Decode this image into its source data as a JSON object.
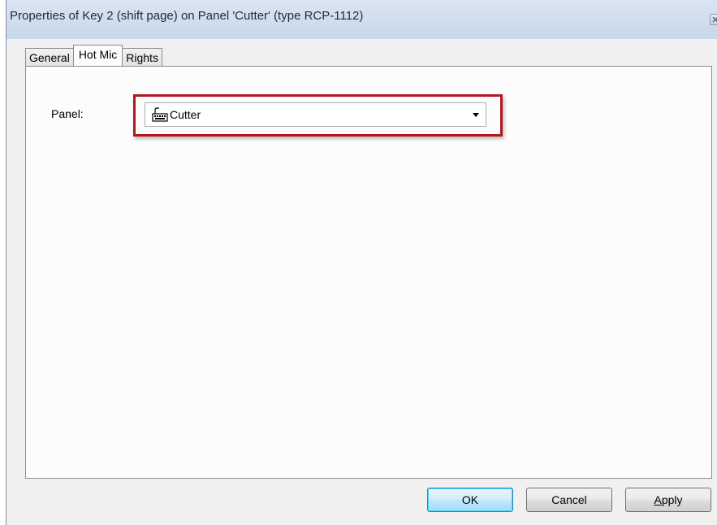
{
  "window": {
    "title": "Properties of Key 2 (shift page) on Panel 'Cutter' (type RCP-1112)"
  },
  "tabs": [
    {
      "label": "General",
      "active": false
    },
    {
      "label": "Hot Mic",
      "active": true
    },
    {
      "label": "Rights",
      "active": false
    }
  ],
  "hot_mic": {
    "panel_label": "Panel:",
    "panel_value": "Cutter",
    "panel_icon": "keyboard-panel-icon",
    "highlight_color": "#b3161d"
  },
  "buttons": {
    "ok_label": "OK",
    "cancel_label": "Cancel",
    "apply_accel": "A",
    "apply_rest": "pply"
  }
}
